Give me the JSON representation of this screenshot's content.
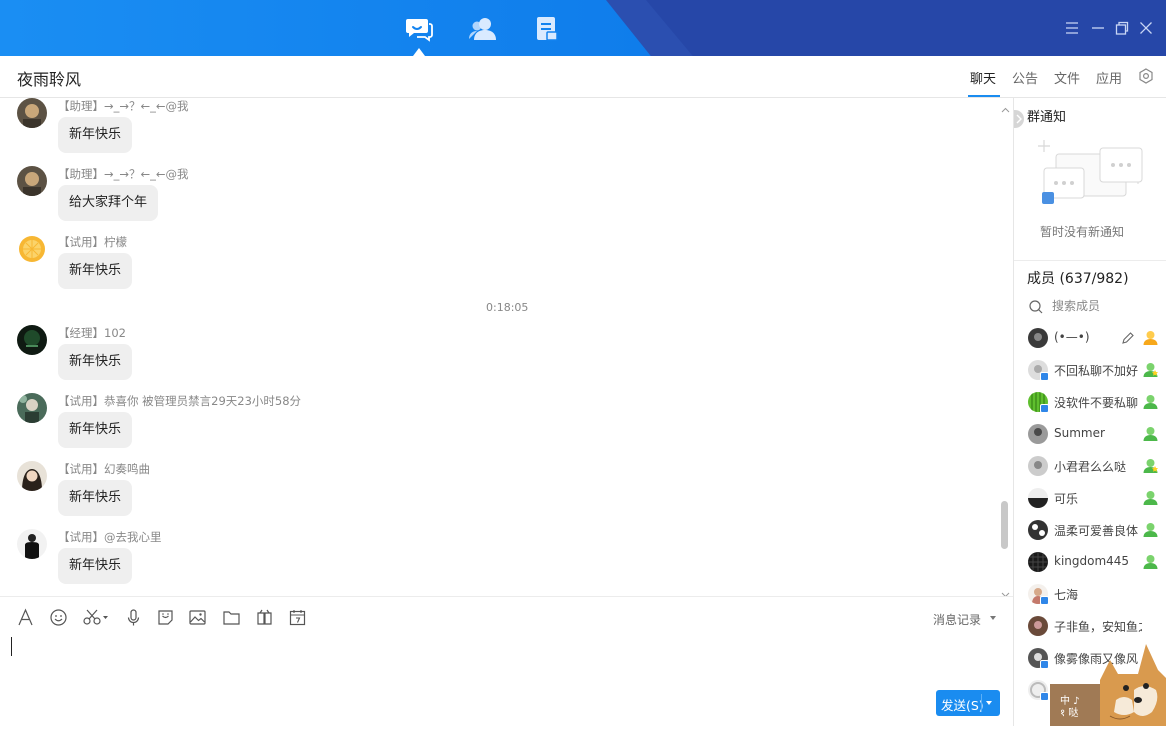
{
  "nav": {
    "active": "chat",
    "icons": [
      "chat-icon",
      "contacts-icon",
      "files-icon"
    ]
  },
  "window_controls": [
    "menu-icon",
    "minimize-icon",
    "maximize-icon",
    "close-icon"
  ],
  "title": "夜雨聆风",
  "tabs": [
    {
      "label": "聊天",
      "active": true
    },
    {
      "label": "公告"
    },
    {
      "label": "文件"
    },
    {
      "label": "应用"
    }
  ],
  "messages": [
    {
      "sender": "【助理】→_→？←_←@我",
      "text": "新年快乐"
    },
    {
      "sender": "【助理】→_→？←_←@我",
      "text": "给大家拜个年"
    },
    {
      "sender": "【试用】柠檬",
      "text": "新年快乐"
    },
    {
      "sender": "【经理】102",
      "text": "新年快乐"
    },
    {
      "sender": "【试用】恭喜你 被管理员禁言29天23小时58分",
      "text": "新年快乐"
    },
    {
      "sender": "【试用】幻奏鸣曲",
      "text": "新年快乐"
    },
    {
      "sender": "【试用】@去我心里",
      "text": "新年快乐"
    }
  ],
  "time_divider": "0:18:05",
  "toolbar": {
    "icons": [
      "font-icon",
      "emoji-icon",
      "screenshot-icon",
      "voice-icon",
      "sticker-icon",
      "image-icon",
      "folder-icon",
      "gift-icon",
      "calendar-icon"
    ],
    "history_label": "消息记录"
  },
  "send_label": "发送(S)",
  "notice": {
    "title": "群通知",
    "empty": "暂时没有新通知"
  },
  "members": {
    "title": "成员 (637/982)",
    "search_placeholder": "搜索成员",
    "list": [
      {
        "name": "(•—•)",
        "role": "owner"
      },
      {
        "name": "不回私聊不加好",
        "role": "admin"
      },
      {
        "name": "没软件不要私聊",
        "role": "member"
      },
      {
        "name": "Summer",
        "role": "member"
      },
      {
        "name": "小君君么么哒",
        "role": "admin"
      },
      {
        "name": "可乐",
        "role": "member"
      },
      {
        "name": "温柔可爱善良体",
        "role": "member"
      },
      {
        "name": "kingdom445",
        "role": "member"
      },
      {
        "name": "七海",
        "role": ""
      },
      {
        "name": "子非鱼，安知鱼之？",
        "role": ""
      },
      {
        "name": "像雾像雨又像风",
        "role": ""
      },
      {
        "name": "",
        "role": ""
      }
    ]
  },
  "colors": {
    "accent": "#1a8cf0",
    "topbar": "#1283f0",
    "topbar_dark": "#2b4fb0",
    "bubble": "#efefef"
  },
  "sticker_text": "中 ♪\n१ 哒"
}
